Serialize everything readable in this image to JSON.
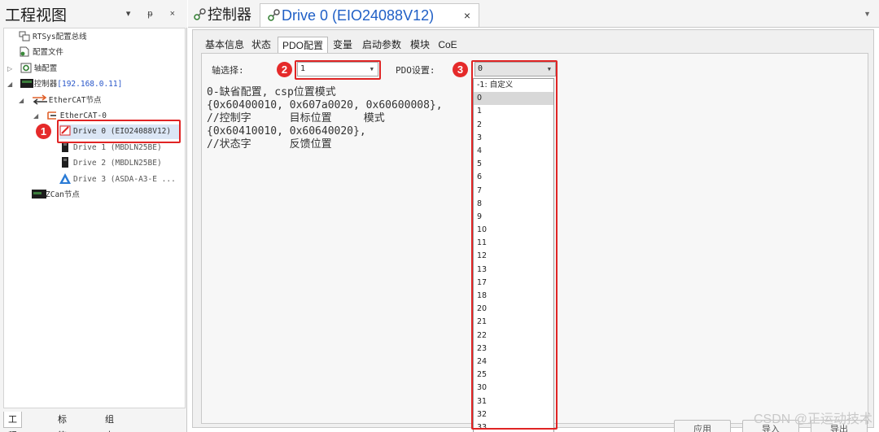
{
  "project_panel": {
    "title": "工程视图",
    "header_buttons": "▾ ᵽ ×",
    "tree": {
      "rtsys_bus": "RTSys配置总线",
      "config_file": "配置文件",
      "axis_config": "轴配置",
      "controller_label": "控制器",
      "controller_ip": "[192.168.0.11]",
      "ethercat_node": "EtherCAT节点",
      "ethercat_0": "EtherCAT-0",
      "drive_0": "Drive 0 (EIO24088V12)",
      "drive_1": "Drive 1 (MBDLN25BE)",
      "drive_2": "Drive 2 (MBDLN25BE)",
      "drive_3": "Drive 3 (ASDA-A3-E ...",
      "zcan_node": "ZCan节点"
    },
    "bottom_tabs": [
      "工程视图",
      "标签视图",
      "组态视图"
    ]
  },
  "document_tabs": {
    "controller_tab": "控制器",
    "drive_tab": "Drive 0 (EIO24088V12)",
    "close_symbol": "×",
    "menu_symbol": "▼"
  },
  "page_tabs": [
    "基本信息",
    "状态",
    "PDO配置",
    "变量",
    "启动参数",
    "模块",
    "CoE"
  ],
  "pdo_config": {
    "axis_select_label": "轴选择:",
    "axis_select_value": "1",
    "pdo_setting_label": "PDO设置:",
    "pdo_setting_value": "0",
    "description_lines": [
      "0-缺省配置, csp位置模式",
      "{0x60400010, 0x607a0020, 0x60600008},",
      "//控制字      目标位置     模式",
      "{0x60410010, 0x60640020},",
      "//状态字      反馈位置"
    ],
    "pdo_options": [
      "-1: 自定义",
      "0",
      "1",
      "2",
      "3",
      "4",
      "5",
      "6",
      "7",
      "8",
      "9",
      "10",
      "11",
      "12",
      "13",
      "17",
      "18",
      "20",
      "21",
      "22",
      "23",
      "24",
      "25",
      "30",
      "31",
      "32",
      "33"
    ],
    "selected_option": "0"
  },
  "action_buttons": {
    "apply": "应用",
    "import": "导入",
    "export": "导出"
  },
  "annotations": {
    "badge_1": "1",
    "badge_2": "2",
    "badge_3": "3",
    "highlight_color": "#e02424"
  },
  "watermark": "CSDN @正运动技术"
}
